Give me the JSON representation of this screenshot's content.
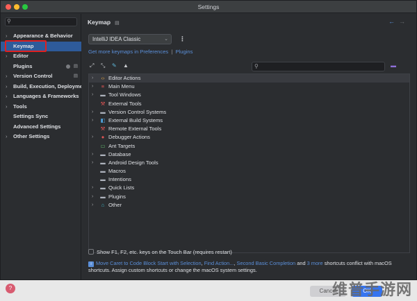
{
  "window": {
    "title": "Settings"
  },
  "sidebar": {
    "search_placeholder": "",
    "items": [
      {
        "label": "Appearance & Behavior",
        "expandable": true
      },
      {
        "label": "Keymap",
        "expandable": false,
        "selected": true
      },
      {
        "label": "Editor",
        "expandable": true
      },
      {
        "label": "Plugins",
        "expandable": false
      },
      {
        "label": "Version Control",
        "expandable": true
      },
      {
        "label": "Build, Execution, Deployment",
        "expandable": true
      },
      {
        "label": "Languages & Frameworks",
        "expandable": true
      },
      {
        "label": "Tools",
        "expandable": true
      },
      {
        "label": "Settings Sync",
        "expandable": false
      },
      {
        "label": "Advanced Settings",
        "expandable": false
      },
      {
        "label": "Other Settings",
        "expandable": true
      }
    ]
  },
  "main": {
    "heading": "Keymap",
    "keymap_value": "IntelliJ IDEA Classic",
    "links": {
      "get_more": "Get more keymaps in Preferences",
      "separator": "|",
      "plugins": "Plugins"
    },
    "filter_placeholder": "",
    "tree": [
      {
        "label": "Editor Actions",
        "icon": "code-icon",
        "expandable": true
      },
      {
        "label": "Main Menu",
        "icon": "menu-icon",
        "expandable": true
      },
      {
        "label": "Tool Windows",
        "icon": "folder-icon",
        "expandable": true
      },
      {
        "label": "External Tools",
        "icon": "wrench-icon",
        "expandable": false
      },
      {
        "label": "Version Control Systems",
        "icon": "folder-icon",
        "expandable": true
      },
      {
        "label": "External Build Systems",
        "icon": "build-icon",
        "expandable": true
      },
      {
        "label": "Remote External Tools",
        "icon": "wrench-icon",
        "expandable": false
      },
      {
        "label": "Debugger Actions",
        "icon": "bug-icon",
        "expandable": true
      },
      {
        "label": "Ant Targets",
        "icon": "ant-icon",
        "expandable": false
      },
      {
        "label": "Database",
        "icon": "folder-icon",
        "expandable": true
      },
      {
        "label": "Android Design Tools",
        "icon": "folder-icon",
        "expandable": true
      },
      {
        "label": "Macros",
        "icon": "folder-icon",
        "expandable": false
      },
      {
        "label": "Intentions",
        "icon": "folder-icon",
        "expandable": false
      },
      {
        "label": "Quick Lists",
        "icon": "folder-icon",
        "expandable": true
      },
      {
        "label": "Plugins",
        "icon": "folder-icon",
        "expandable": true
      },
      {
        "label": "Other",
        "icon": "other-icon",
        "expandable": true
      }
    ],
    "touchbar_label": "Show F1, F2, etc. keys on the Touch Bar (requires restart)",
    "conflict": {
      "link1": "Move Caret to Code Block Start with Selection",
      "sep1": ", ",
      "link2": "Find Action...",
      "sep2": ", ",
      "link3": "Second Basic Completion",
      "and": " and ",
      "link4": "3 more",
      "tail": " shortcuts conflict with macOS shortcuts. Assign custom shortcuts or change the macOS system settings."
    }
  },
  "footer": {
    "help": "?",
    "cancel": "Cancel",
    "ok": "OK"
  },
  "watermark": "维普手游网"
}
